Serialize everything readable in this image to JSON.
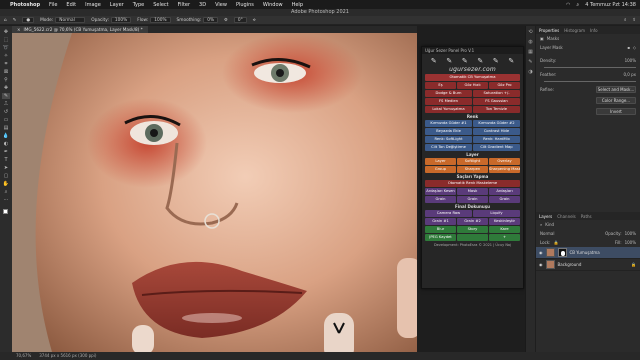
{
  "menubar": {
    "app": "Photoshop",
    "items": [
      "File",
      "Edit",
      "Image",
      "Layer",
      "Type",
      "Select",
      "Filter",
      "3D",
      "View",
      "Plugins",
      "Window",
      "Help"
    ],
    "datetime": "4 Temmuz Pzt 14:38"
  },
  "window": {
    "title": "Adobe Photoshop 2021"
  },
  "options": {
    "mode_label": "Mode:",
    "mode_value": "Normal",
    "opacity_label": "Opacity:",
    "opacity_value": "100%",
    "flow_label": "Flow:",
    "flow_value": "100%",
    "smoothing_label": "Smoothing:",
    "smoothing_value": "0%",
    "angle_value": "0°"
  },
  "document": {
    "tab_title": "IMG_5622.cr2 @ 70,6% (CB Yumuşatma, Layer Mask/8) *"
  },
  "status": {
    "zoom": "70,67%",
    "dims": "3744 px x 5616 px (300 ppi)"
  },
  "plugin": {
    "title": "Uğur Sezer Panel Pro V.1",
    "logo": "ugursezer.com",
    "buttons_row1": [
      "Otomatik CB Yumuşatma"
    ],
    "buttons_row2": [
      "Eş",
      "Göz Hızlı",
      "Göz Pro"
    ],
    "buttons_row3": [
      "Dodge & Burn",
      "Saturation +/-"
    ],
    "buttons_row4": [
      "FS Medien",
      "FS Gaussian"
    ],
    "buttons_row5": [
      "Lokal Yumuşatma",
      "Ton Temizle"
    ],
    "section_renk": "Renk",
    "renk_row1": [
      "Kırmızıda Güder #1",
      "Kırmızıda Güder #2"
    ],
    "renk_row2": [
      "Beyazda Ekle",
      "Contrast Hide"
    ],
    "renk_row3": [
      "Renk: SoftLight",
      "Renk: HardMix"
    ],
    "renk_row4": [
      "Cilt Ton Değiştirme",
      "Cilt Gradient Map"
    ],
    "section_layer": "Layer",
    "layer_row1": [
      "Layer",
      "Softlight",
      "Overlay"
    ],
    "layer_row2": [
      "Group",
      "Sharpen",
      "Sharpening Mask"
    ],
    "section_sac": "Saçları Yapma",
    "sac_row1": [
      "Otomatik Renk Maskeleme"
    ],
    "sac_row2": [
      "Ardaşları Kesen",
      "Mask",
      "Ardaşları"
    ],
    "sac_row3": [
      "Grain",
      "Grain",
      "Grain"
    ],
    "section_final": "Final Dokunuşu",
    "final_row1": [
      "Camera Raw",
      "Liquify"
    ],
    "final_row2": [
      "Grain #1",
      "Grain #2",
      "Keskinleştir"
    ],
    "final_row3": [
      "Blur",
      "Story",
      "Kare"
    ],
    "final_row4": [
      "JPEG Kaydet",
      "",
      "+"
    ],
    "footer": "Development: PhotoEsra © 2021   |   Ücuy Naj"
  },
  "properties": {
    "tabs": [
      "Properties",
      "Histogram",
      "Info"
    ],
    "layer_label": "Masks",
    "sub_label": "Layer Mask",
    "density_label": "Density:",
    "density_value": "100%",
    "feather_label": "Feather:",
    "feather_value": "0,0 px",
    "refine_label": "Refine:",
    "select_mask": "Select and Mask...",
    "color_range": "Color Range...",
    "invert": "Invert"
  },
  "layers": {
    "tabs": [
      "Layers",
      "Channels",
      "Paths"
    ],
    "kind": "Kind",
    "blend": "Normal",
    "opacity_label": "Opacity:",
    "opacity_value": "100%",
    "lock_label": "Lock:",
    "fill_label": "Fill:",
    "fill_value": "100%",
    "items": [
      {
        "name": "CB Yumuşatma"
      },
      {
        "name": "Background"
      }
    ]
  }
}
